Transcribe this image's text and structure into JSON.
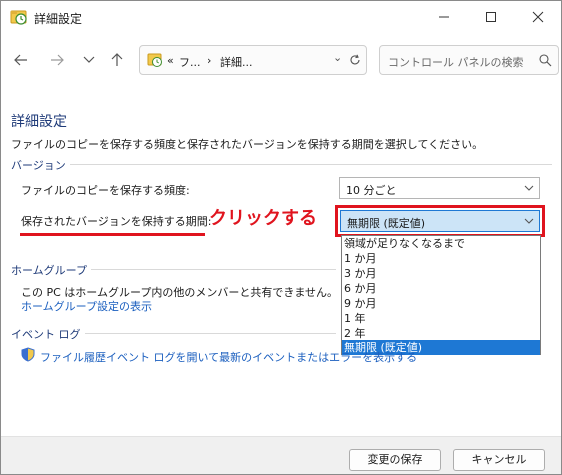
{
  "window": {
    "title": "詳細設定"
  },
  "address": {
    "prefix": "«",
    "crumb1": "フ...",
    "sep": "›",
    "crumb2": "詳細...",
    "chevron": "⌄"
  },
  "search": {
    "placeholder": "コントロール パネルの検索"
  },
  "page": {
    "heading": "詳細設定",
    "description": "ファイルのコピーを保存する頻度と保存されたバージョンを保持する期間を選択してください。"
  },
  "versions": {
    "group_label": "バージョン",
    "frequency_label": "ファイルのコピーを保存する頻度:",
    "frequency_value": "10 分ごと",
    "retention_label": "保存されたバージョンを保持する期間:",
    "retention_value": "無期限 (既定値)",
    "retention_options": [
      "領域が足りなくなるまで",
      "1 か月",
      "3 か月",
      "6 か月",
      "9 か月",
      "1 年",
      "2 年",
      "無期限 (既定値)"
    ],
    "selected_index": 7
  },
  "annotation": {
    "text": "クリックする",
    "color": "#e0141e"
  },
  "homegroup": {
    "group_label": "ホームグループ",
    "text": "この PC はホームグループ内の他のメンバーと共有できません。",
    "link": "ホームグループ設定の表示"
  },
  "eventlog": {
    "group_label": "イベント ログ",
    "link": "ファイル履歴イベント ログを開いて最新のイベントまたはエラーを表示する"
  },
  "footer": {
    "save_label": "変更の保存",
    "cancel_label": "キャンセル"
  },
  "colors": {
    "accent": "#1e78d4",
    "heading": "#1e3a78",
    "link": "#1b5fbf"
  }
}
